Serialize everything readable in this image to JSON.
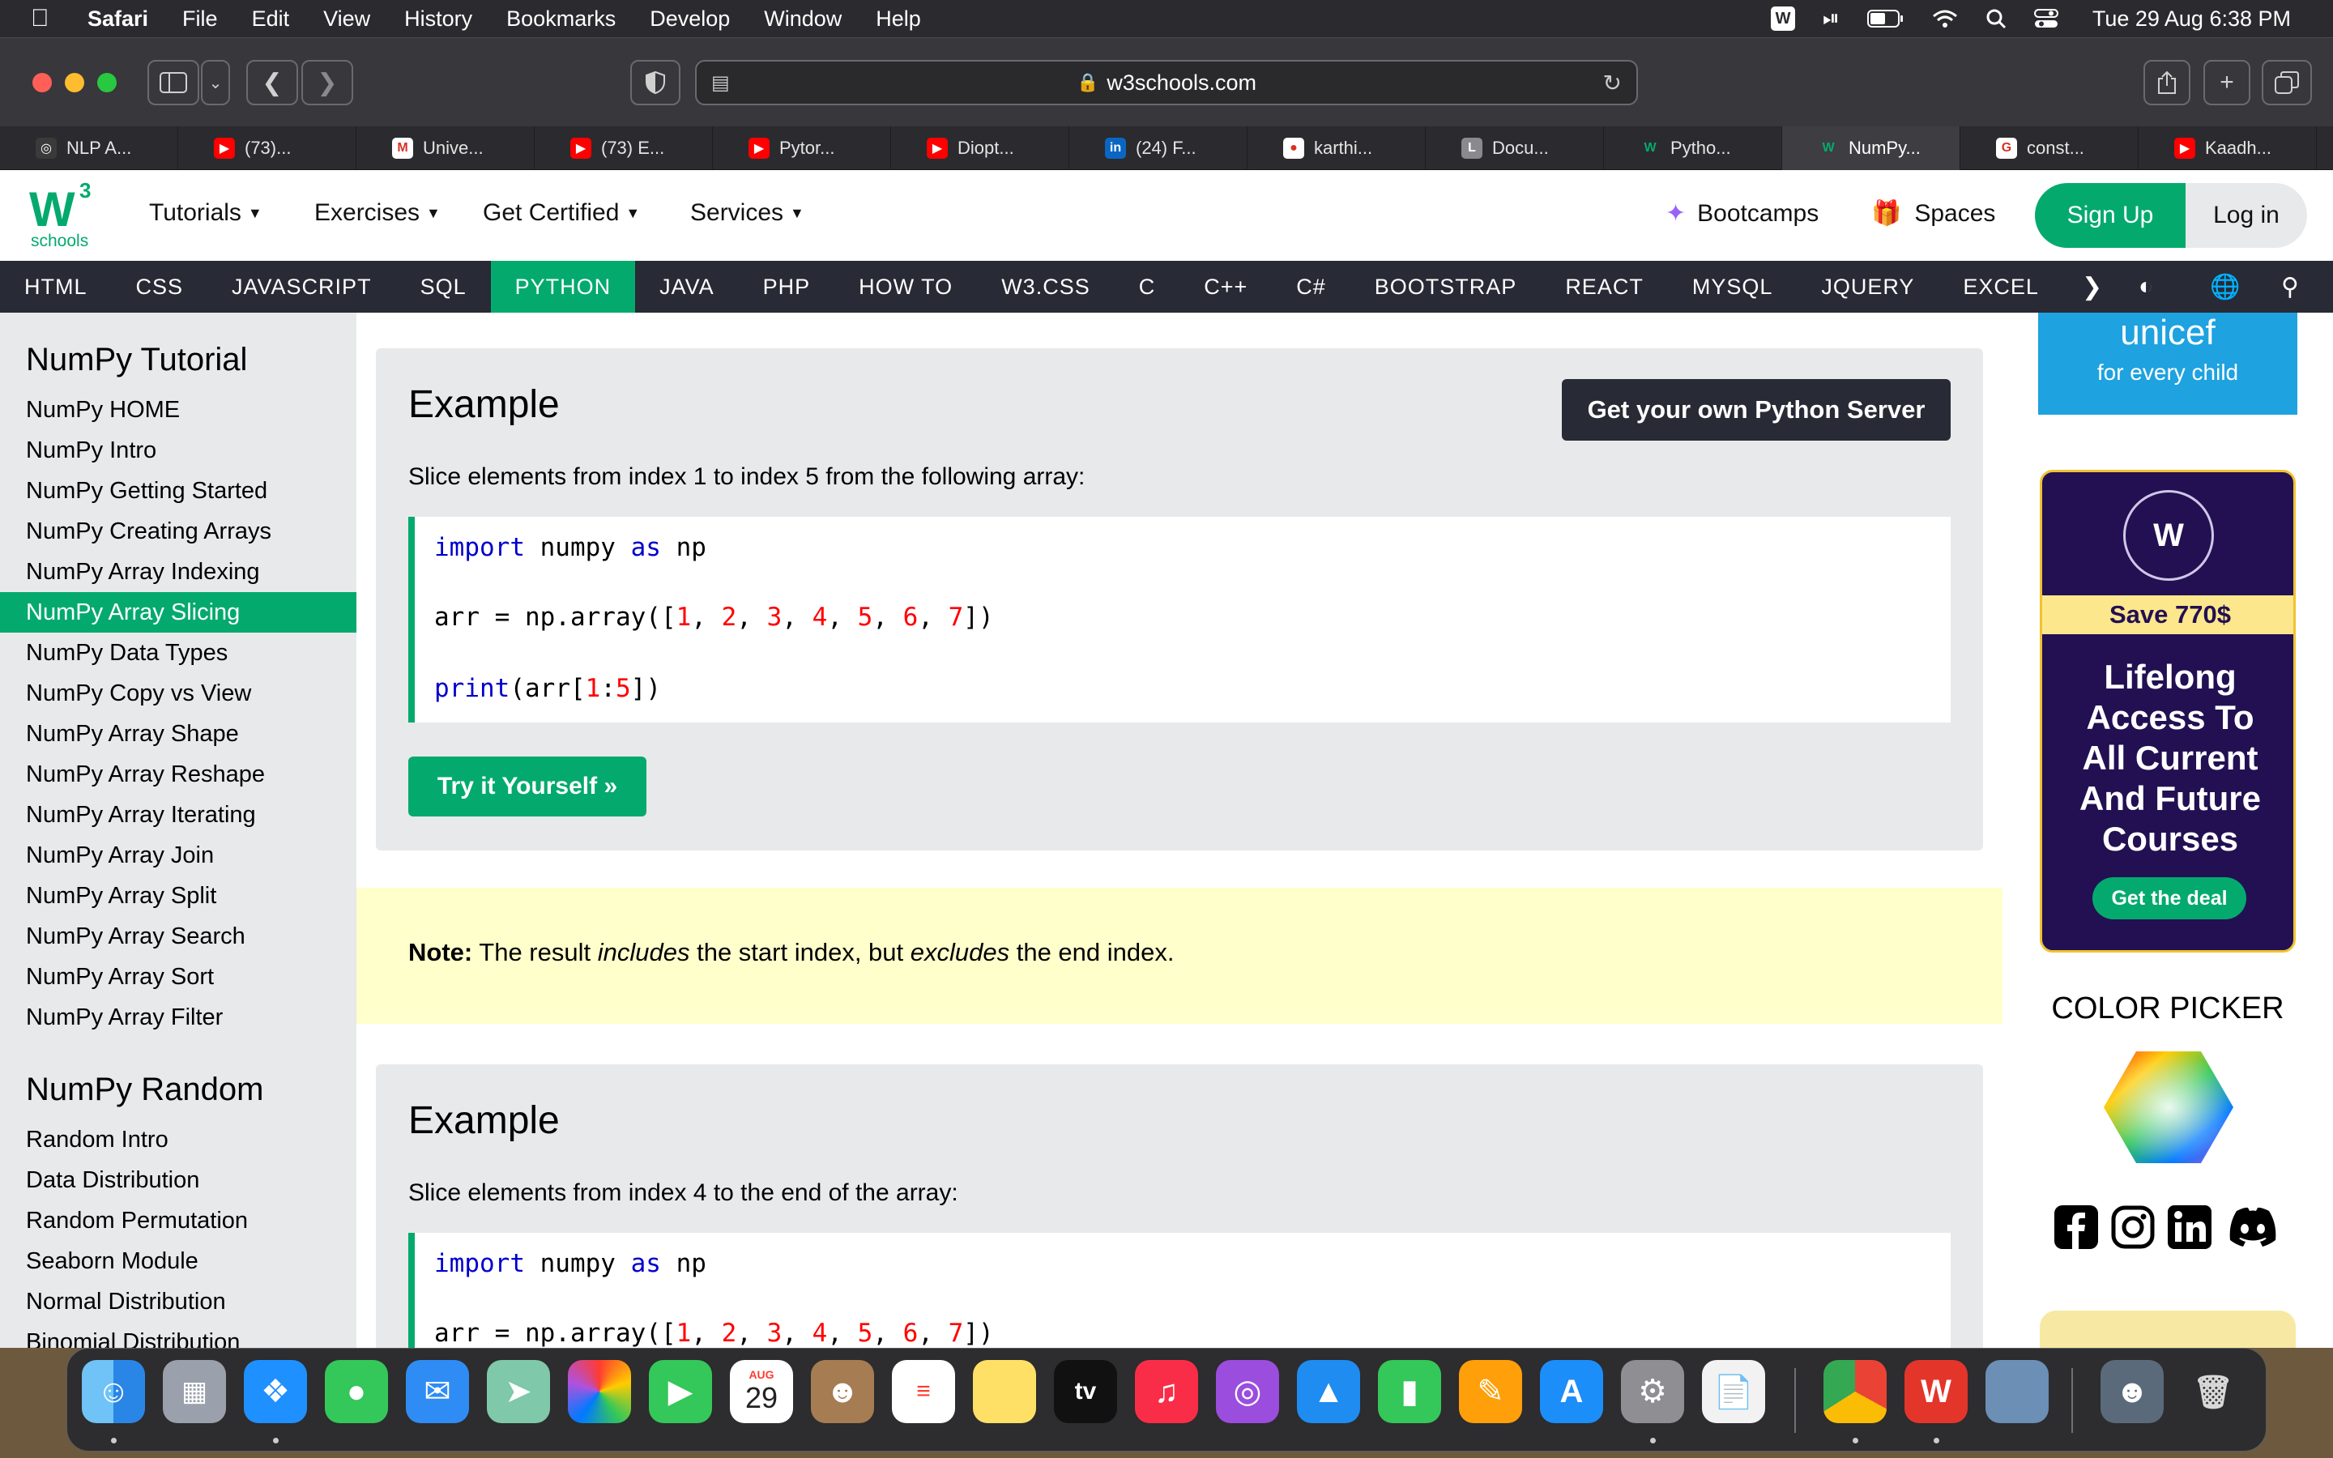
{
  "menubar": {
    "app": "Safari",
    "items": [
      "File",
      "Edit",
      "View",
      "History",
      "Bookmarks",
      "Develop",
      "Window",
      "Help"
    ],
    "clock": "Tue 29 Aug  6:38 PM"
  },
  "browser": {
    "url": "w3schools.com",
    "tabs": [
      {
        "label": "NLP A...",
        "icon": "openai-icon",
        "color": "#3a3a3a",
        "glyph": "◎"
      },
      {
        "label": "(73)...",
        "icon": "youtube-icon",
        "color": "#ff0000",
        "glyph": "▶"
      },
      {
        "label": "Unive...",
        "icon": "gmail-icon",
        "color": "#ffffff",
        "glyph": "M"
      },
      {
        "label": "(73) E...",
        "icon": "youtube-icon",
        "color": "#ff0000",
        "glyph": "▶"
      },
      {
        "label": "Pytor...",
        "icon": "youtube-icon",
        "color": "#ff0000",
        "glyph": "▶"
      },
      {
        "label": "Diopt...",
        "icon": "youtube-icon",
        "color": "#ff0000",
        "glyph": "▶"
      },
      {
        "label": "(24) F...",
        "icon": "linkedin-icon",
        "color": "#0a66c2",
        "glyph": "in"
      },
      {
        "label": "karthi...",
        "icon": "github-icon",
        "color": "#ffffff",
        "glyph": "●"
      },
      {
        "label": "Docu...",
        "icon": "docs-icon",
        "color": "#8a8a8e",
        "glyph": "L"
      },
      {
        "label": "Pytho...",
        "icon": "w3schools-icon",
        "color": "#2b2a2e",
        "glyph": "W"
      },
      {
        "label": "NumPy...",
        "icon": "w3schools-icon",
        "color": "#3e3d41",
        "glyph": "W"
      },
      {
        "label": "const...",
        "icon": "google-icon",
        "color": "#ffffff",
        "glyph": "G"
      },
      {
        "label": "Kaadh...",
        "icon": "youtube-icon",
        "color": "#ff0000",
        "glyph": "▶"
      }
    ],
    "active_tab": 10
  },
  "w3": {
    "logo_main": "W",
    "logo_sup": "3",
    "logo_sub": "schools",
    "nav": [
      "Tutorials",
      "Exercises",
      "Get Certified",
      "Services"
    ],
    "bootcamps": "Bootcamps",
    "spaces": "Spaces",
    "signup": "Sign Up",
    "login": "Log in",
    "subnav": [
      "HTML",
      "CSS",
      "JAVASCRIPT",
      "SQL",
      "PYTHON",
      "JAVA",
      "PHP",
      "HOW TO",
      "W3.CSS",
      "C",
      "C++",
      "C#",
      "BOOTSTRAP",
      "REACT",
      "MYSQL",
      "JQUERY",
      "EXCEL"
    ],
    "subnav_active": "PYTHON"
  },
  "sidebar": {
    "title1": "NumPy Tutorial",
    "links1": [
      "NumPy HOME",
      "NumPy Intro",
      "NumPy Getting Started",
      "NumPy Creating Arrays",
      "NumPy Array Indexing",
      "NumPy Array Slicing",
      "NumPy Data Types",
      "NumPy Copy vs View",
      "NumPy Array Shape",
      "NumPy Array Reshape",
      "NumPy Array Iterating",
      "NumPy Array Join",
      "NumPy Array Split",
      "NumPy Array Search",
      "NumPy Array Sort",
      "NumPy Array Filter"
    ],
    "active_link": "NumPy Array Slicing",
    "title2": "NumPy Random",
    "links2": [
      "Random Intro",
      "Data Distribution",
      "Random Permutation",
      "Seaborn Module",
      "Normal Distribution",
      "Binomial Distribution"
    ]
  },
  "content": {
    "example1": {
      "title": "Example",
      "server_button": "Get your own Python Server",
      "desc": "Slice elements from index 1 to index 5 from the following array:",
      "try_button": "Try it Yourself »"
    },
    "note": {
      "label": "Note:",
      "t1": " The result ",
      "em1": "includes",
      "t2": " the start index, but ",
      "em2": "excludes",
      "t3": " the end index."
    },
    "example2": {
      "title": "Example",
      "desc": "Slice elements from index 4 to the end of the array:"
    }
  },
  "right": {
    "unicef": "unicef",
    "unicef_tag": "for every child",
    "ad_save": "Save 770$",
    "ad_headline": [
      "Lifelong",
      "Access To",
      "All Current",
      "And Future",
      "Courses"
    ],
    "ad_button": "Get the deal",
    "color_picker": "COLOR PICKER",
    "social": [
      "facebook-icon",
      "instagram-icon",
      "linkedin-icon",
      "discord-icon"
    ]
  },
  "dock": {
    "day": "29",
    "month": "AUG",
    "tv": "tv"
  }
}
